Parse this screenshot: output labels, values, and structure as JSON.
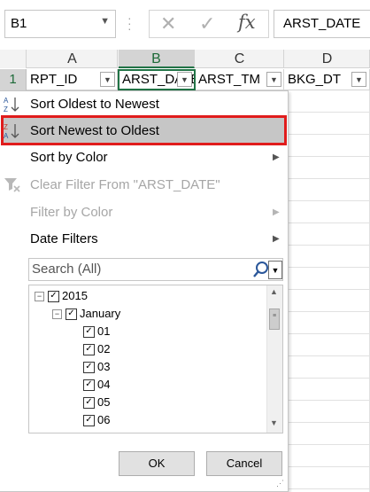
{
  "formula_bar": {
    "name_box": "B1",
    "cancel_glyph": "✕",
    "enter_glyph": "✓",
    "fx_label": "fx",
    "content": "ARST_DATE"
  },
  "grid": {
    "columns": [
      "A",
      "B",
      "C",
      "D"
    ],
    "selected_column": "B",
    "row_number": "1",
    "cells": [
      "RPT_ID",
      "ARST_DATE",
      "ARST_TM",
      "BKG_DT"
    ]
  },
  "menu": {
    "sort_asc": "Sort Oldest to Newest",
    "sort_desc": "Sort Newest to Oldest",
    "sort_color": "Sort by Color",
    "clear_filter": "Clear Filter From \"ARST_DATE\"",
    "filter_color": "Filter by Color",
    "date_filters": "Date Filters",
    "search_placeholder": "Search (All)",
    "tree": {
      "year": "2015",
      "month": "January",
      "days": [
        "01",
        "02",
        "03",
        "04",
        "05",
        "06"
      ]
    },
    "ok_label": "OK",
    "cancel_label": "Cancel"
  },
  "colors": {
    "highlight_border": "#e01c1c",
    "accent_green": "#217346"
  },
  "icons": {
    "sort_asc": "sort-ascending-icon",
    "sort_desc": "sort-descending-icon",
    "clear_filter": "clear-filter-icon",
    "search": "search-icon"
  }
}
